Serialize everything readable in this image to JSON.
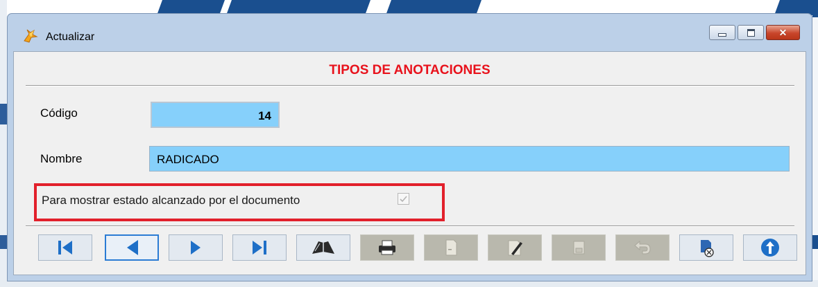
{
  "window": {
    "title": "Actualizar"
  },
  "form": {
    "heading": "TIPOS DE ANOTACIONES",
    "codigo_label": "Código",
    "codigo_value": "14",
    "nombre_label": "Nombre",
    "nombre_value": "RADICADO",
    "checkbox_label": "Para mostrar estado alcanzado por el documento",
    "checkbox_checked": true
  },
  "toolbar": {
    "buttons": [
      {
        "icon": "first-record-icon",
        "enabled": true
      },
      {
        "icon": "previous-record-icon",
        "enabled": true,
        "selected": true
      },
      {
        "icon": "next-record-icon",
        "enabled": true
      },
      {
        "icon": "last-record-icon",
        "enabled": true
      },
      {
        "icon": "search-book-icon",
        "enabled": true
      },
      {
        "icon": "print-icon",
        "enabled": false
      },
      {
        "icon": "new-document-icon",
        "enabled": false
      },
      {
        "icon": "edit-icon",
        "enabled": false
      },
      {
        "icon": "save-icon",
        "enabled": false
      },
      {
        "icon": "undo-icon",
        "enabled": false
      },
      {
        "icon": "delete-icon",
        "enabled": true
      },
      {
        "icon": "exit-icon",
        "enabled": true
      }
    ]
  },
  "colors": {
    "heading": "#e8121c",
    "field_bg": "#86d0fb",
    "highlight_border": "#e2202b",
    "nav_blue": "#1e6fc7"
  }
}
